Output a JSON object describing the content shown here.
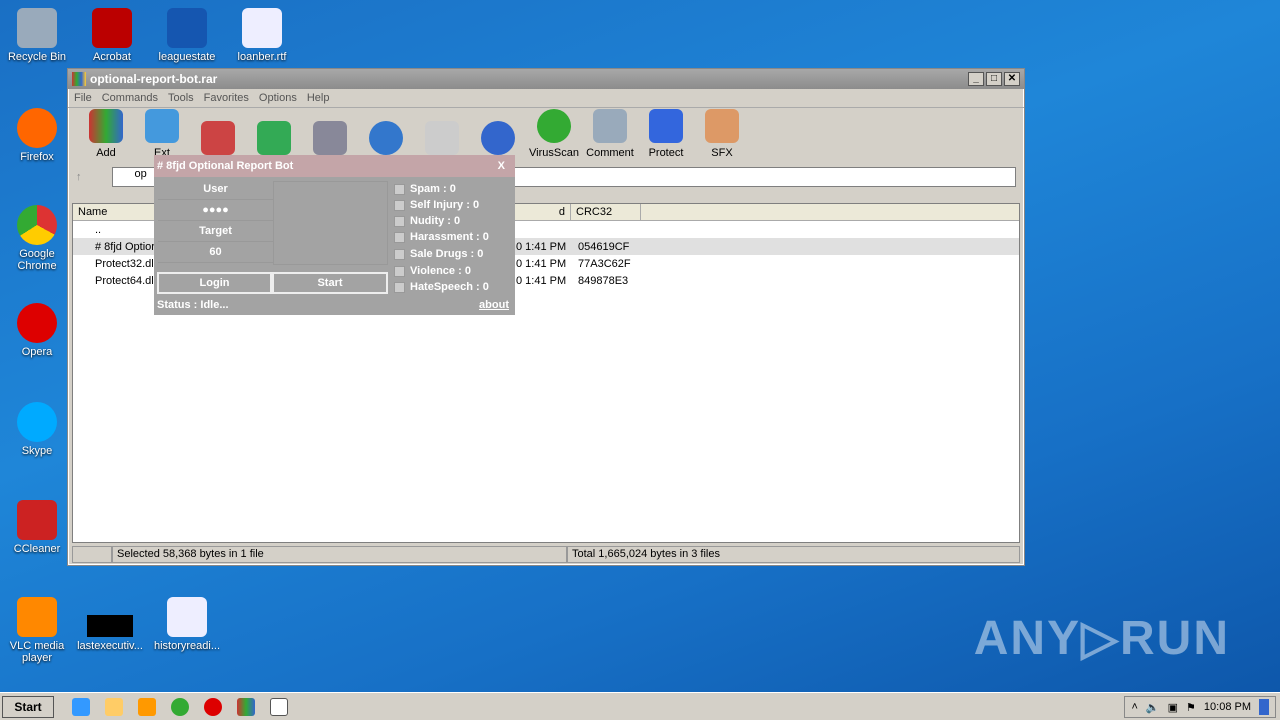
{
  "desktop": {
    "icons": [
      "Recycle Bin",
      "Acrobat",
      "leaguestate",
      "loanber.rtf",
      "Firefox",
      "Google Chrome",
      "Opera",
      "Skype",
      "CCleaner",
      "VLC media player",
      "lastexecutiv...",
      "historyreadi..."
    ]
  },
  "window": {
    "title": "optional-report-bot.rar",
    "menu": [
      "File",
      "Commands",
      "Tools",
      "Favorites",
      "Options",
      "Help"
    ],
    "toolbar": [
      "Add",
      "Ext",
      "",
      "",
      "",
      "",
      "",
      "",
      "VirusScan",
      "Comment",
      "Protect",
      "SFX"
    ],
    "address": "op",
    "columns": [
      "Name",
      "d",
      "CRC32"
    ],
    "files": [
      {
        "name": "..",
        "modified": "",
        "crc": ""
      },
      {
        "name": "# 8fjd Optior",
        "modified": "0 1:41 PM",
        "crc": "054619CF"
      },
      {
        "name": "Protect32.dll",
        "modified": "0 1:41 PM",
        "crc": "77A3C62F"
      },
      {
        "name": "Protect64.dll",
        "modified": "0 1:41 PM",
        "crc": "849878E3"
      }
    ],
    "status_left": "Selected 58,368 bytes in 1 file",
    "status_right": "Total 1,665,024 bytes in 3 files"
  },
  "bot": {
    "title": "# 8fjd Optional Report Bot",
    "close": "X",
    "user_label": "User",
    "password": "●●●●",
    "target_label": "Target",
    "target_value": "60",
    "login": "Login",
    "start": "Start",
    "status": "Status : Idle...",
    "about": "about",
    "checks": [
      "Spam : 0",
      "Self Injury : 0",
      "Nudity :  0",
      "Harassment : 0",
      "Sale Drugs : 0",
      "Violence : 0",
      "HateSpeech : 0"
    ]
  },
  "taskbar": {
    "start": "Start",
    "clock": "10:08 PM"
  },
  "watermark": "ANY▷RUN"
}
